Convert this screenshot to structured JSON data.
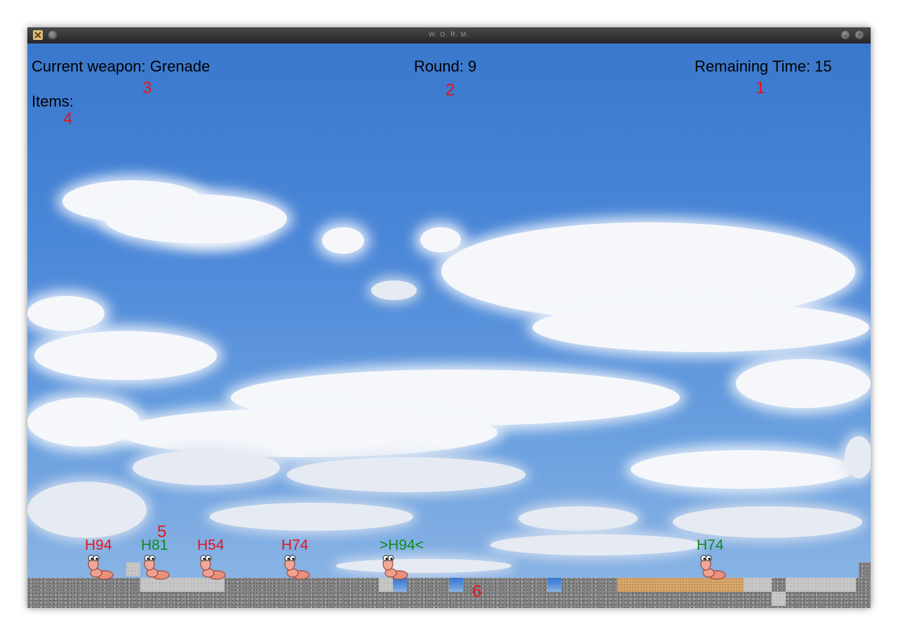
{
  "window": {
    "title": "W. O. R. M."
  },
  "hud": {
    "current_weapon": "Current weapon: Grenade",
    "round": "Round: 9",
    "remaining_time": "Remaining Time: 15",
    "items": "Items:"
  },
  "annotations": [
    "1",
    "2",
    "3",
    "4",
    "5",
    "6"
  ],
  "worms": [
    {
      "label": "H94",
      "team": "red"
    },
    {
      "label": "H81",
      "team": "green"
    },
    {
      "label": "H54",
      "team": "red"
    },
    {
      "label": "H74",
      "team": "red"
    },
    {
      "label": ">H94<",
      "team": "green"
    },
    {
      "label": "H74",
      "team": "green"
    }
  ],
  "colors": {
    "red_team": "#e5141c",
    "green_team": "#0e8a1f",
    "sky": "#4b87d8"
  }
}
